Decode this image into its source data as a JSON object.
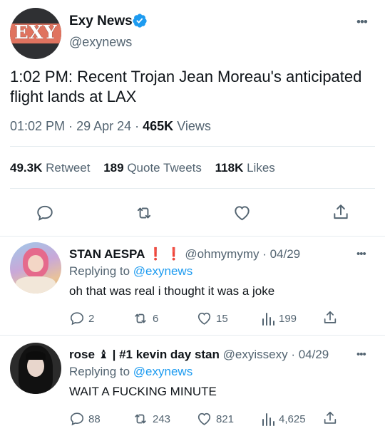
{
  "tweet": {
    "author_name": "Exy News",
    "author_handle": "@exynews",
    "avatar_text": "EXY",
    "text": "1:02 PM: Recent Trojan Jean Moreau's anticipated flight lands at LAX",
    "time": "01:02 PM",
    "date": "29 Apr 24",
    "views_count": "465K",
    "views_label": "Views",
    "retweets_count": "49.3K",
    "retweets_label": "Retweet",
    "quotes_count": "189",
    "quotes_label": "Quote Tweets",
    "likes_count": "118K",
    "likes_label": "Likes",
    "more": "•••"
  },
  "replies": [
    {
      "name": "STAN AESPA",
      "name_suffix": "❗ ❗",
      "handle": "@ohmymymy",
      "date": "04/29",
      "replying_prefix": "Replying to",
      "replying_to": "@exynews",
      "text": "oh that was real i thought it was a joke",
      "reply_count": "2",
      "retweet_count": "6",
      "like_count": "15",
      "view_count": "199",
      "more": "•••"
    },
    {
      "name": "rose",
      "name_suffix": "♝ | #1 kevin day stan",
      "handle": "@exyissexy",
      "date": "04/29",
      "replying_prefix": "Replying to",
      "replying_to": "@exynews",
      "text": "WAIT A FUCKING MINUTE",
      "reply_count": "88",
      "retweet_count": "243",
      "like_count": "821",
      "view_count": "4,625",
      "more": "•••"
    }
  ],
  "colors": {
    "accent": "#1d9bf0",
    "muted": "#536471",
    "text": "#0f1419",
    "divider": "#e6ecf0"
  },
  "icons": [
    "verified-badge-icon",
    "reply-icon",
    "retweet-icon",
    "like-icon",
    "share-icon",
    "views-icon",
    "more-icon"
  ]
}
